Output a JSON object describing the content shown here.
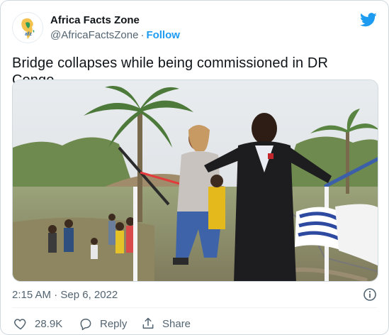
{
  "author": {
    "name": "Africa Facts Zone",
    "handle": "@AfricaFactsZone",
    "separator": "·",
    "follow_label": "Follow",
    "avatar_icon": "africa-map-logo",
    "avatar_text": "afz"
  },
  "tweet": {
    "text": "Bridge collapses while being commissioned in DR Congo.",
    "timestamp": "2:15 AM · Sep 6, 2022"
  },
  "actions": {
    "likes_count": "28.9K",
    "reply_label": "Reply",
    "share_label": "Share"
  },
  "icons": {
    "brand": "twitter-bird-icon",
    "info": "info-icon",
    "like": "heart-icon",
    "reply": "reply-bubble-icon",
    "share": "share-upload-icon"
  },
  "colors": {
    "accent": "#1d9bf0",
    "text_primary": "#0f1419",
    "text_secondary": "#536471",
    "border": "#cfd9de"
  }
}
